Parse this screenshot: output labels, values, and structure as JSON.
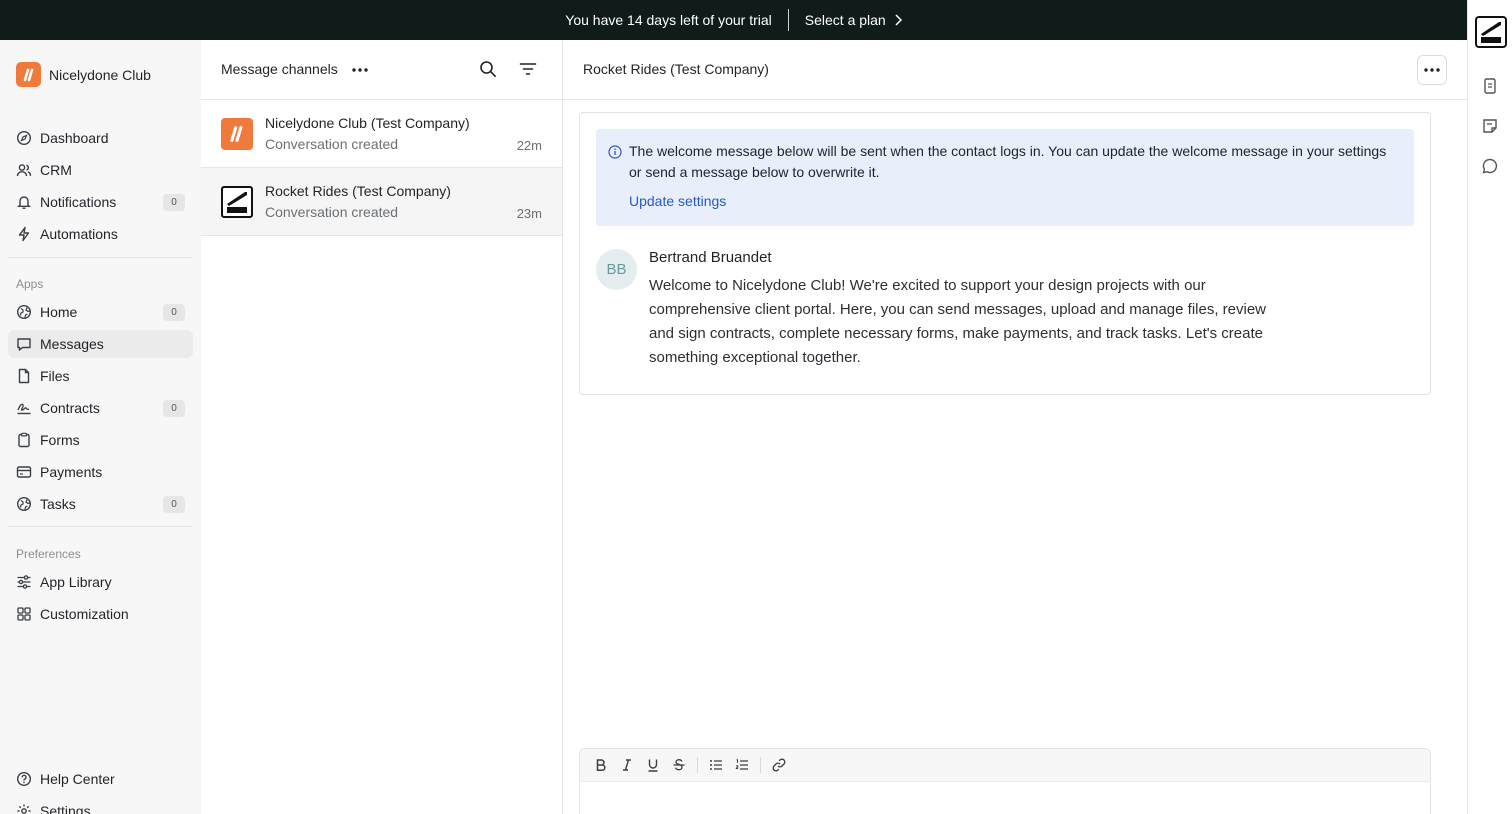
{
  "banner": {
    "trial_text": "You have 14 days left of your trial",
    "plan_label": "Select a plan"
  },
  "sidebar": {
    "org_name": "Nicelydone Club",
    "primary_items": [
      {
        "label": "Dashboard",
        "icon": "compass-icon"
      },
      {
        "label": "CRM",
        "icon": "users-icon"
      },
      {
        "label": "Notifications",
        "icon": "bell-icon",
        "count": "0"
      },
      {
        "label": "Automations",
        "icon": "lightning-icon"
      }
    ],
    "apps_label": "Apps",
    "apps_items": [
      {
        "label": "Home",
        "icon": "globe-icon",
        "count": "0"
      },
      {
        "label": "Messages",
        "icon": "message-icon",
        "active": true
      },
      {
        "label": "Files",
        "icon": "file-icon"
      },
      {
        "label": "Contracts",
        "icon": "signature-icon",
        "count": "0"
      },
      {
        "label": "Forms",
        "icon": "clipboard-icon"
      },
      {
        "label": "Payments",
        "icon": "credit-card-icon"
      },
      {
        "label": "Tasks",
        "icon": "globe-icon",
        "count": "0"
      }
    ],
    "preferences_label": "Preferences",
    "preferences_items": [
      {
        "label": "App Library",
        "icon": "sliders-icon"
      },
      {
        "label": "Customization",
        "icon": "grid-icon"
      }
    ],
    "bottom_items": [
      {
        "label": "Help Center",
        "icon": "help-icon"
      },
      {
        "label": "Settings",
        "icon": "gear-icon"
      }
    ]
  },
  "channels": {
    "title": "Message channels",
    "items": [
      {
        "name": "Nicelydone Club (Test Company)",
        "subtitle": "Conversation created",
        "time": "22m"
      },
      {
        "name": "Rocket Rides (Test Company)",
        "subtitle": "Conversation created",
        "time": "23m"
      }
    ]
  },
  "conversation": {
    "title": "Rocket Rides (Test Company)",
    "notice_text": "The welcome message below will be sent when the contact logs in. You can update the welcome message in your settings or send a message below to overwrite it.",
    "notice_link": "Update settings",
    "message": {
      "initials": "BB",
      "author": "Bertrand Bruandet",
      "body": "Welcome to Nicelydone Club! We're excited to support your design projects with our comprehensive client portal. Here, you can send messages, upload and manage files, review and sign contracts, complete necessary forms, make payments, and track tasks. Let's create something exceptional together."
    }
  },
  "composer": {
    "tools": [
      "bold-icon",
      "italic-icon",
      "underline-icon",
      "strikethrough-icon",
      "bullet-list-icon",
      "numbered-list-icon",
      "link-icon"
    ]
  },
  "colors": {
    "banner_bg": "#101c1a",
    "org_accent": "#ef7a3c",
    "notice_bg": "#e8effb",
    "link": "#2a57c9"
  }
}
